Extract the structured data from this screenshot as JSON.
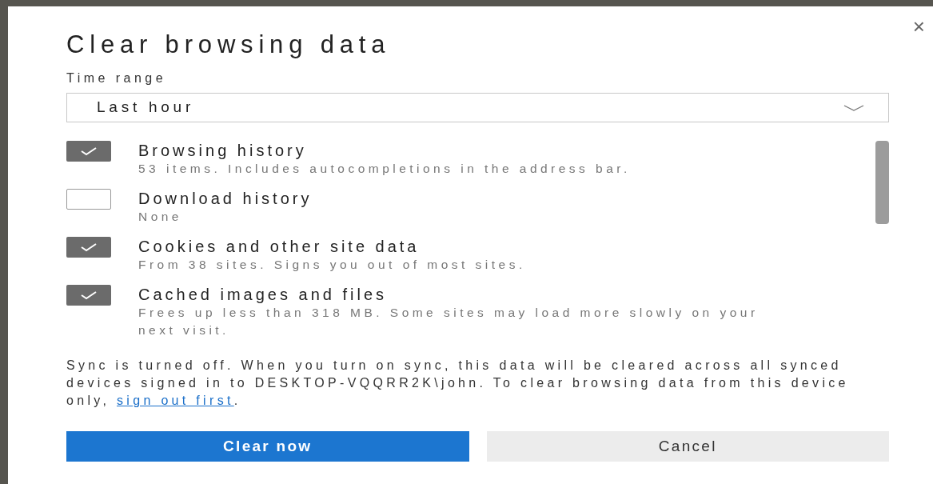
{
  "dialog": {
    "title": "Clear browsing data",
    "close": "×"
  },
  "time_range": {
    "label": "Time range",
    "value": "Last hour"
  },
  "items": [
    {
      "title": "Browsing history",
      "detail": "53 items. Includes autocompletions in the address bar.",
      "checked": true
    },
    {
      "title": "Download history",
      "detail": "None",
      "checked": false
    },
    {
      "title": "Cookies and other site data",
      "detail": "From 38 sites. Signs you out of most sites.",
      "checked": true
    },
    {
      "title": "Cached images and files",
      "detail": "Frees up less than 318 MB. Some sites may load more slowly on your next visit.",
      "checked": true
    }
  ],
  "sync_notice": {
    "text": "Sync is turned off. When you turn on sync, this data will be cleared across all synced devices signed in to DESKTOP-VQQRR2K\\john. To clear browsing data from this device only, ",
    "link": "sign out first",
    "end": "."
  },
  "buttons": [
    {
      "label": "Clear now",
      "kind": "primary"
    },
    {
      "label": "Cancel",
      "kind": "secondary"
    }
  ]
}
